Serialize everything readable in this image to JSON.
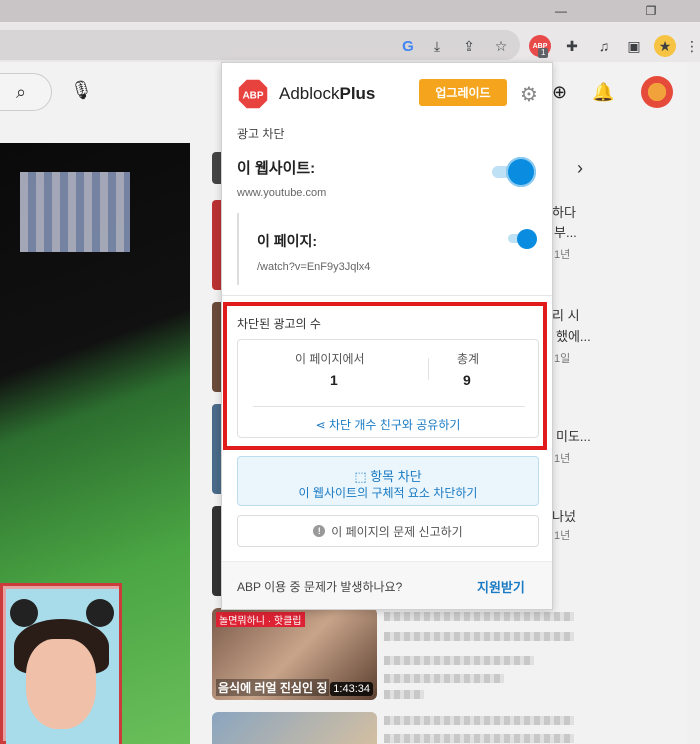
{
  "popup": {
    "brand_light": "Adblock",
    "brand_bold": "Plus",
    "upgrade_label": "업그레이드",
    "section_title": "광고 차단",
    "site_label": "이 웹사이트:",
    "site_url": "www.youtube.com",
    "page_label": "이 페이지:",
    "page_url": "/watch?v=EnF9y3Jqlx4",
    "blocked_title": "차단된 광고의 수",
    "stats": {
      "this_page_label": "이 페이지에서",
      "this_page_value": "1",
      "total_label": "총계",
      "total_value": "9"
    },
    "share_label": "차단 개수 친구와 공유하기",
    "block_element_title": "항목 차단",
    "block_element_sub": "이 웹사이트의 구체적 요소 차단하기",
    "report_label": "이 페이지의 문제 신고하기",
    "help_question": "ABP 이용 중 문제가 발생하나요?",
    "help_link": "지원받기",
    "site_toggle_on": true,
    "page_toggle_on": true
  },
  "toolbar": {
    "ext_badge": "1",
    "icons": [
      "google-icon",
      "install-icon",
      "share-icon",
      "bookmark-star-icon",
      "abp-extension-icon",
      "puzzle-icon",
      "media-icon",
      "sidepanel-icon",
      "profile-avatar",
      "kebab-menu-icon"
    ]
  },
  "youtube": {
    "rail": [
      {
        "title": "하다",
        "sub": "부...",
        "meta": "1년"
      },
      {
        "title": "리 시",
        "sub": "했에...",
        "meta": "1일"
      },
      {
        "title": "",
        "sub": "미도...",
        "meta": "1년"
      },
      {
        "title": "나넜",
        "sub": "",
        "meta": "1년"
      }
    ],
    "thumb1": {
      "top": "놀면뭐하니 · 핫클립",
      "caption": "음식에 러얼 진심인 징",
      "duration": "1:43:34"
    }
  },
  "colors": {
    "abp_red": "#e8423f",
    "upgrade_orange": "#f4a51d",
    "toggle_blue": "#0a8de0",
    "link_blue": "#1a7bc4",
    "highlight_red": "#e01b1b"
  }
}
